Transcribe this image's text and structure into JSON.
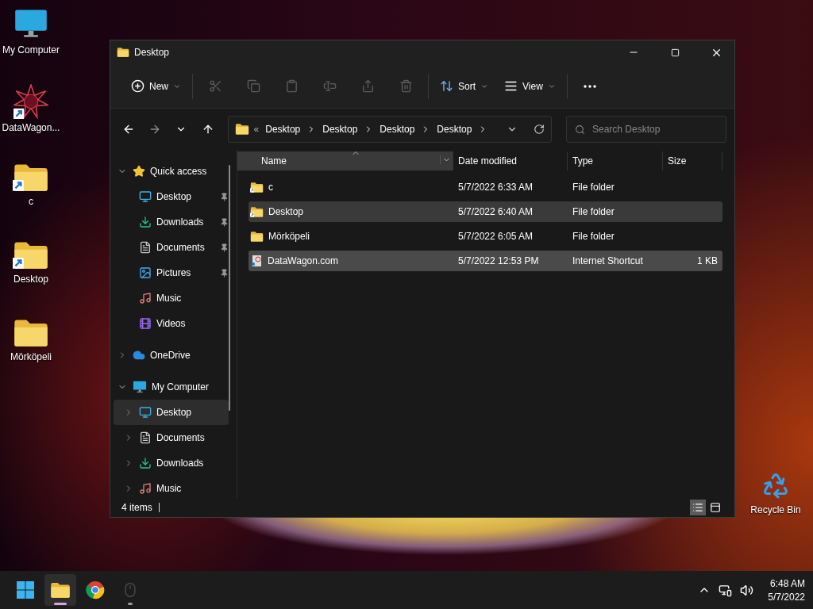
{
  "desktop_icons": [
    {
      "label": "My Computer",
      "kind": "computer",
      "shortcut": false
    },
    {
      "label": "DataWagon...",
      "kind": "web",
      "shortcut": true
    },
    {
      "label": "c",
      "kind": "folder",
      "shortcut": true
    },
    {
      "label": "Desktop",
      "kind": "folder",
      "shortcut": true
    },
    {
      "label": "Mörköpeli",
      "kind": "folder",
      "shortcut": false
    }
  ],
  "recycle_bin": {
    "label": "Recycle Bin"
  },
  "window": {
    "title": "Desktop"
  },
  "command_bar": {
    "groups": [
      [
        {
          "kind": "new",
          "label": "New",
          "disabled": false
        }
      ],
      [
        {
          "kind": "cut",
          "disabled": true
        },
        {
          "kind": "copy",
          "disabled": true
        },
        {
          "kind": "paste",
          "disabled": true
        },
        {
          "kind": "rename",
          "disabled": true
        },
        {
          "kind": "share",
          "disabled": true
        },
        {
          "kind": "delete",
          "disabled": true
        }
      ],
      [
        {
          "kind": "sort",
          "label": "Sort",
          "disabled": false
        },
        {
          "kind": "view",
          "label": "View",
          "disabled": false
        }
      ],
      [
        {
          "kind": "more",
          "disabled": false
        }
      ]
    ]
  },
  "nav_buttons": [
    {
      "kind": "back",
      "disabled": false
    },
    {
      "kind": "forward",
      "disabled": true
    },
    {
      "kind": "recent",
      "disabled": false
    },
    {
      "kind": "up",
      "disabled": false
    }
  ],
  "address_bar": {
    "overflow": "«",
    "segments": [
      "Desktop",
      "Desktop",
      "Desktop",
      "Desktop"
    ]
  },
  "search": {
    "placeholder": "Search Desktop"
  },
  "navigation_pane": {
    "items": [
      {
        "label": "Quick access",
        "kind": "star",
        "expanded": true,
        "selected": false,
        "children": [
          {
            "label": "Desktop",
            "kind": "desktop",
            "pinned": true,
            "selected": false
          },
          {
            "label": "Downloads",
            "kind": "downloads",
            "pinned": true,
            "selected": false
          },
          {
            "label": "Documents",
            "kind": "documents",
            "pinned": true,
            "selected": false
          },
          {
            "label": "Pictures",
            "kind": "pictures",
            "pinned": true,
            "selected": false
          },
          {
            "label": "Music",
            "kind": "music",
            "pinned": false,
            "selected": false
          },
          {
            "label": "Videos",
            "kind": "videos",
            "pinned": false,
            "selected": false
          }
        ]
      },
      {
        "label": "OneDrive",
        "kind": "cloud",
        "expanded": false,
        "selected": false
      },
      {
        "label": "My Computer",
        "kind": "computer",
        "expanded": true,
        "selected": false,
        "children": [
          {
            "label": "Desktop",
            "kind": "desktop",
            "expanded": false,
            "selected": true
          },
          {
            "label": "Documents",
            "kind": "documents",
            "expanded": false,
            "selected": false
          },
          {
            "label": "Downloads",
            "kind": "downloads",
            "expanded": false,
            "selected": false
          },
          {
            "label": "Music",
            "kind": "music",
            "expanded": false,
            "selected": false
          }
        ]
      }
    ]
  },
  "file_list": {
    "columns": [
      {
        "label": "Name",
        "sorted": true,
        "hovered": true
      },
      {
        "label": "Date modified",
        "sorted": false,
        "hovered": false
      },
      {
        "label": "Type",
        "sorted": false,
        "hovered": false
      },
      {
        "label": "Size",
        "sorted": false,
        "hovered": false
      }
    ],
    "rows": [
      {
        "name": "c",
        "kind": "folder",
        "shortcut": true,
        "date": "5/7/2022 6:33 AM",
        "type": "File folder",
        "selected": false,
        "hovered": false
      },
      {
        "name": "Desktop",
        "kind": "folder",
        "shortcut": true,
        "date": "5/7/2022 6:40 AM",
        "type": "File folder",
        "selected": false,
        "hovered": true
      },
      {
        "name": "Mörköpeli",
        "kind": "folder",
        "shortcut": false,
        "date": "5/7/2022 6:05 AM",
        "type": "File folder",
        "selected": false,
        "hovered": false
      },
      {
        "name": "DataWagon.com",
        "kind": "web",
        "shortcut": true,
        "date": "5/7/2022 12:53 PM",
        "type": "Internet Shortcut",
        "size": "1 KB",
        "selected": true,
        "hovered": false
      }
    ]
  },
  "status_bar": {
    "count": "4 items",
    "views": [
      {
        "kind": "details",
        "selected": true
      },
      {
        "kind": "tiles",
        "selected": false
      }
    ]
  },
  "taskbar": {
    "apps": [
      {
        "kind": "start",
        "running": false,
        "active": false
      },
      {
        "kind": "explorer",
        "running": true,
        "active": true
      },
      {
        "kind": "chrome",
        "running": false,
        "active": false
      },
      {
        "kind": "mouse",
        "running": true,
        "active": false
      }
    ],
    "tray": {
      "time": "6:48 AM",
      "date": "5/7/2022"
    }
  }
}
